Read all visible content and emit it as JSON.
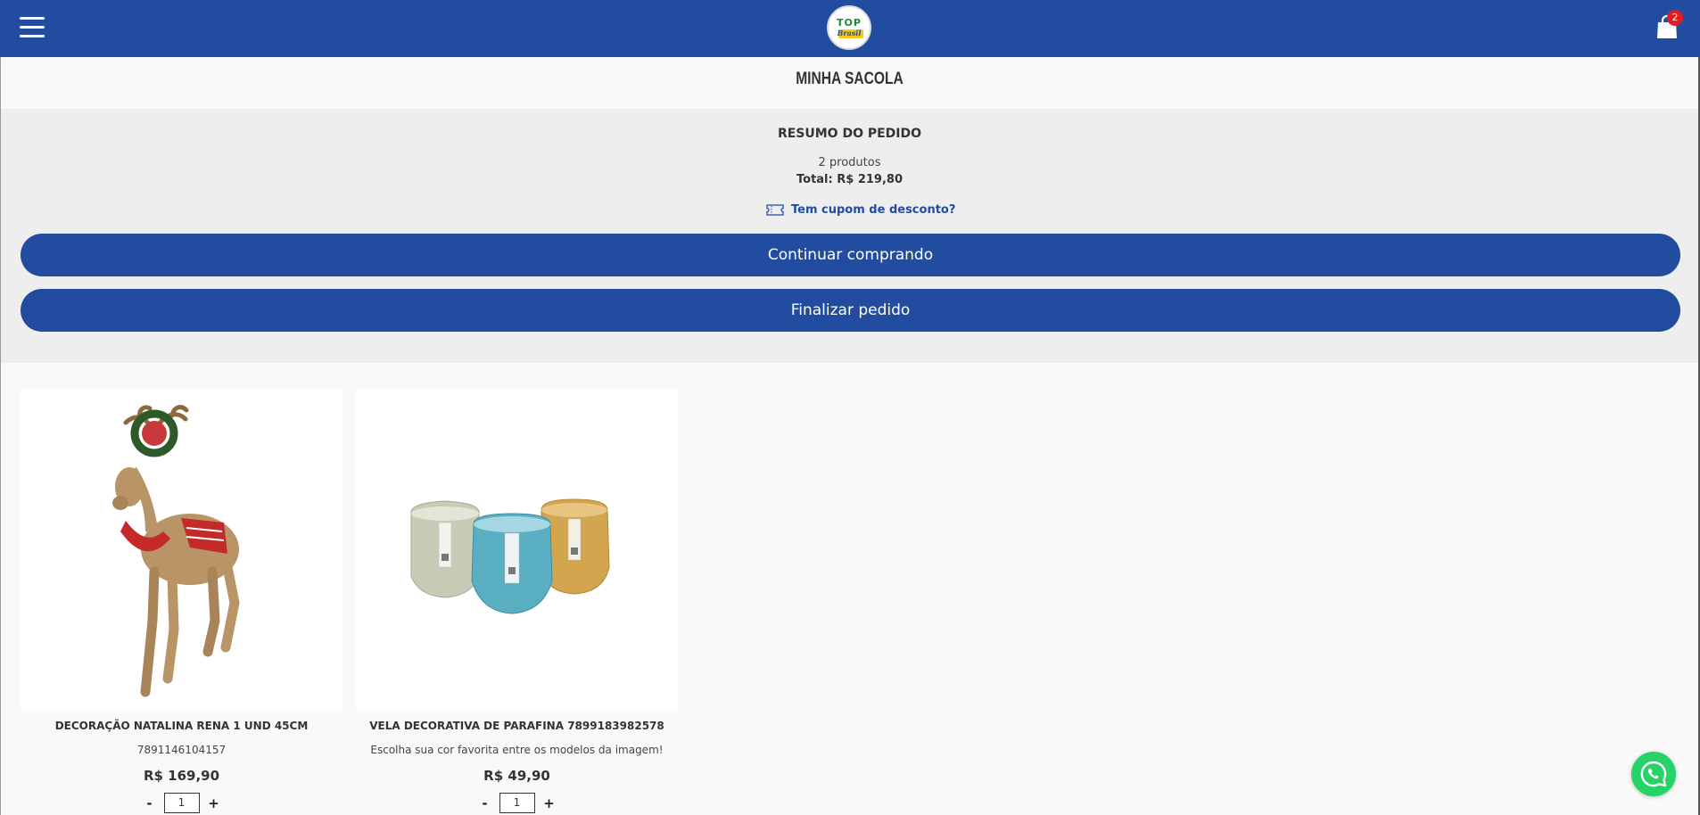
{
  "header": {
    "menu_icon": "hamburger-menu-icon",
    "logo_top": "TOP",
    "logo_bottom": "Brasil",
    "bag_icon": "shopping-bag-icon",
    "bag_count": "2",
    "brand_color": "#214ca0",
    "badge_color": "#e11c22"
  },
  "page_title": "MINHA SACOLA",
  "summary": {
    "title": "RESUMO DO PEDIDO",
    "count": "2 produtos",
    "total": "Total: R$ 219,80",
    "coupon_icon": "ticket-icon",
    "coupon_label": "Tem cupom de desconto?",
    "continue_label": "Continuar comprando",
    "finish_label": "Finalizar pedido"
  },
  "products": [
    {
      "name": "DECORAÇÃO NATALINA RENA 1 UND 45CM",
      "subtitle": "7891146104157",
      "price": "R$ 169,90",
      "quantity": "1",
      "decrement": "-",
      "increment": "+"
    },
    {
      "name": "VELA DECORATIVA DE PARAFINA 7899183982578",
      "subtitle": "Escolha sua cor favorita entre os modelos da imagem!",
      "price": "R$ 49,90",
      "quantity": "1",
      "decrement": "-",
      "increment": "+"
    }
  ],
  "whatsapp_icon": "whatsapp-icon"
}
